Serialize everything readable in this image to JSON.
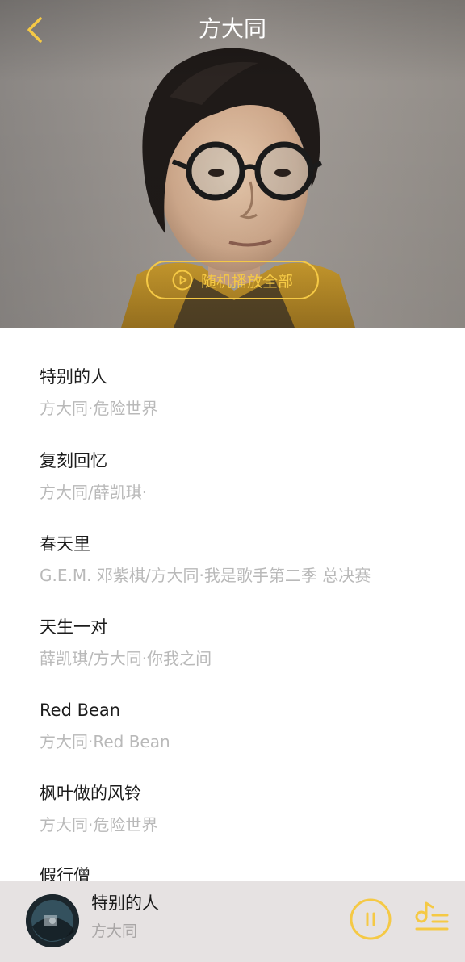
{
  "header": {
    "title": "方大同",
    "shuffle_label": "随机播放全部"
  },
  "songs": [
    {
      "title": "特别的人",
      "subtitle": "方大同·危险世界"
    },
    {
      "title": "复刻回忆",
      "subtitle": "方大同/薛凯琪·"
    },
    {
      "title": "春天里",
      "subtitle": "G.E.M. 邓紫棋/方大同·我是歌手第二季 总决赛"
    },
    {
      "title": "天生一对",
      "subtitle": "薛凯琪/方大同·你我之间"
    },
    {
      "title": "Red Bean",
      "subtitle": "方大同·Red Bean"
    },
    {
      "title": "枫叶做的风铃",
      "subtitle": "方大同·危险世界"
    },
    {
      "title": "假行僧",
      "subtitle": ""
    }
  ],
  "player": {
    "title": "特别的人",
    "artist": "方大同"
  },
  "colors": {
    "accent": "#f5c945",
    "title_text": "#1c1c1c",
    "sub_text": "#b9b9b9",
    "player_bg": "#e6e2e2"
  },
  "icons": {
    "back": "chevron-left-icon",
    "shuffle_play": "play-circle-icon",
    "pause": "pause-circle-icon",
    "playlist": "playlist-icon"
  }
}
